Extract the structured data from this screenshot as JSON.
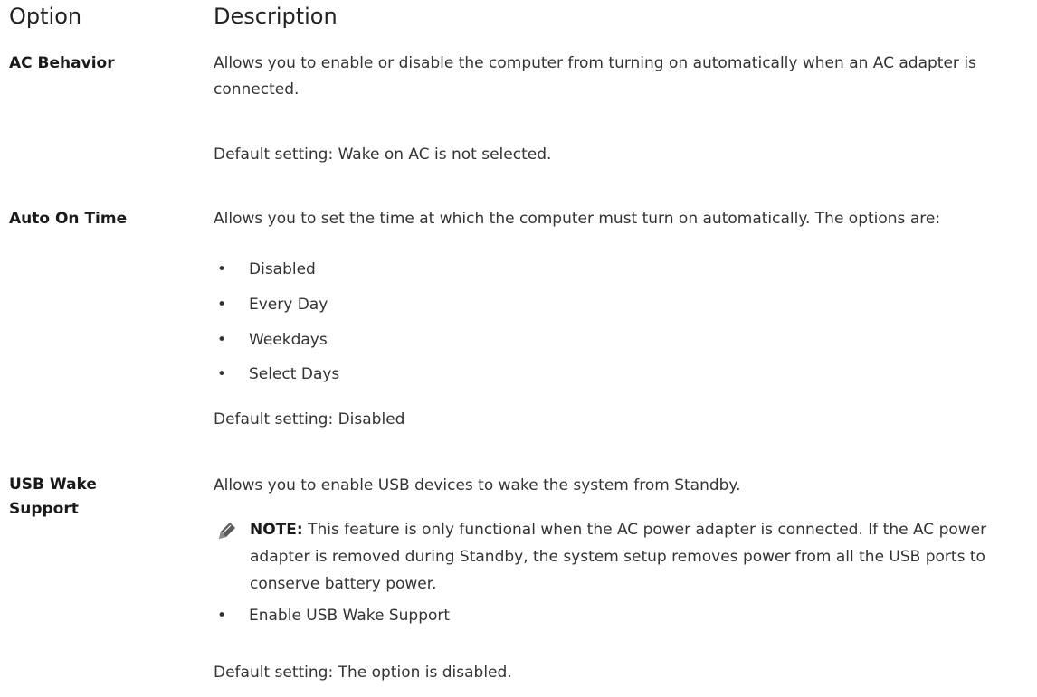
{
  "headers": {
    "option": "Option",
    "description": "Description"
  },
  "options": [
    {
      "name": "AC Behavior",
      "desc": "Allows you to enable or disable the computer from turning on automatically when an AC adapter is connected.",
      "default": "Default setting: Wake on AC is not selected."
    },
    {
      "name": "Auto On Time",
      "desc": "Allows you to set the time at which the computer must turn on automatically. The options are:",
      "bullets": [
        "Disabled",
        "Every Day",
        "Weekdays",
        "Select Days"
      ],
      "default": "Default setting: Disabled"
    },
    {
      "name_line1": "USB Wake",
      "name_line2": "Support",
      "desc": "Allows you to enable USB devices to wake the system from Standby.",
      "note_label": "NOTE:",
      "note_text": " This feature is only functional when the AC power adapter is connected. If the AC power adapter is removed during Standby, the system setup removes power from all the USB ports to conserve battery power.",
      "bullets": [
        "Enable USB Wake Support"
      ],
      "default": "Default setting: The option is disabled."
    }
  ],
  "icons": {
    "note": "pencil-icon"
  },
  "colors": {
    "text": "#333333",
    "heading": "#222222"
  }
}
